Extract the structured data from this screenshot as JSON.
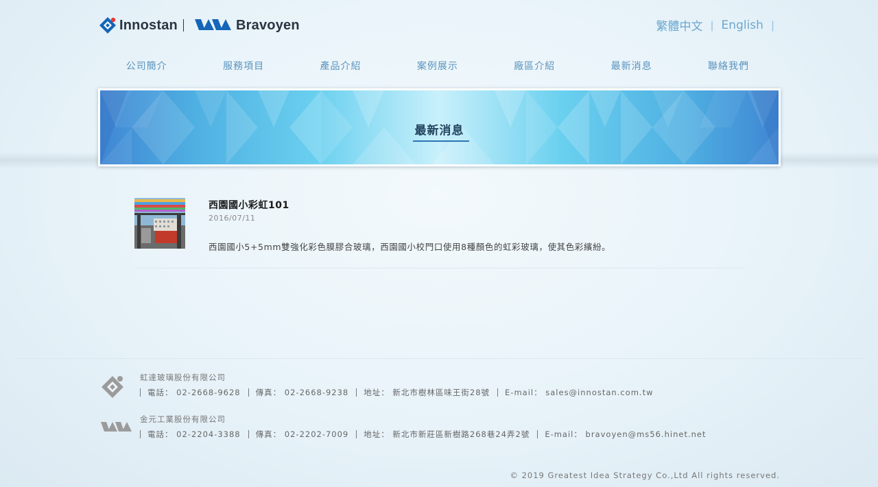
{
  "header": {
    "logo_innostan": "Innostan",
    "logo_bravoyen": "Bravoyen",
    "lang_zh": "繁體中文",
    "lang_en": "English"
  },
  "nav": [
    {
      "label": "公司簡介"
    },
    {
      "label": "服務項目"
    },
    {
      "label": "產品介紹"
    },
    {
      "label": "案例展示"
    },
    {
      "label": "廠區介紹"
    },
    {
      "label": "最新消息"
    },
    {
      "label": "聯絡我們"
    }
  ],
  "banner": {
    "title": "最新消息"
  },
  "news": [
    {
      "title": "西園國小彩虹101",
      "date": "2016/07/11",
      "description": "西園國小5+5mm雙強化彩色膜膠合玻璃，西園國小校門口使用8種顏色的虹彩玻璃，使其色彩繽紛。"
    }
  ],
  "footer": {
    "companies": [
      {
        "name": "虹達玻璃股份有限公司",
        "phone": "電話： 02-2668-9628",
        "fax": "傳真： 02-2668-9238",
        "address": "地址： 新北市樹林區味王街28號",
        "email": "E-mail： sales@innostan.com.tw"
      },
      {
        "name": "金元工業股份有限公司",
        "phone": "電話： 02-2204-3388",
        "fax": "傳真： 02-2202-7009",
        "address": "地址： 新北市新莊區新樹路268巷24弄2號",
        "email": "E-mail： bravoyen@ms56.hinet.net"
      }
    ],
    "copyright": "© 2019 Greatest Idea Strategy Co.,Ltd All rights reserved."
  },
  "colors": {
    "accent": "#2c74b2",
    "nav_text": "#5a93bd",
    "lang_text": "#6aa7cf"
  }
}
